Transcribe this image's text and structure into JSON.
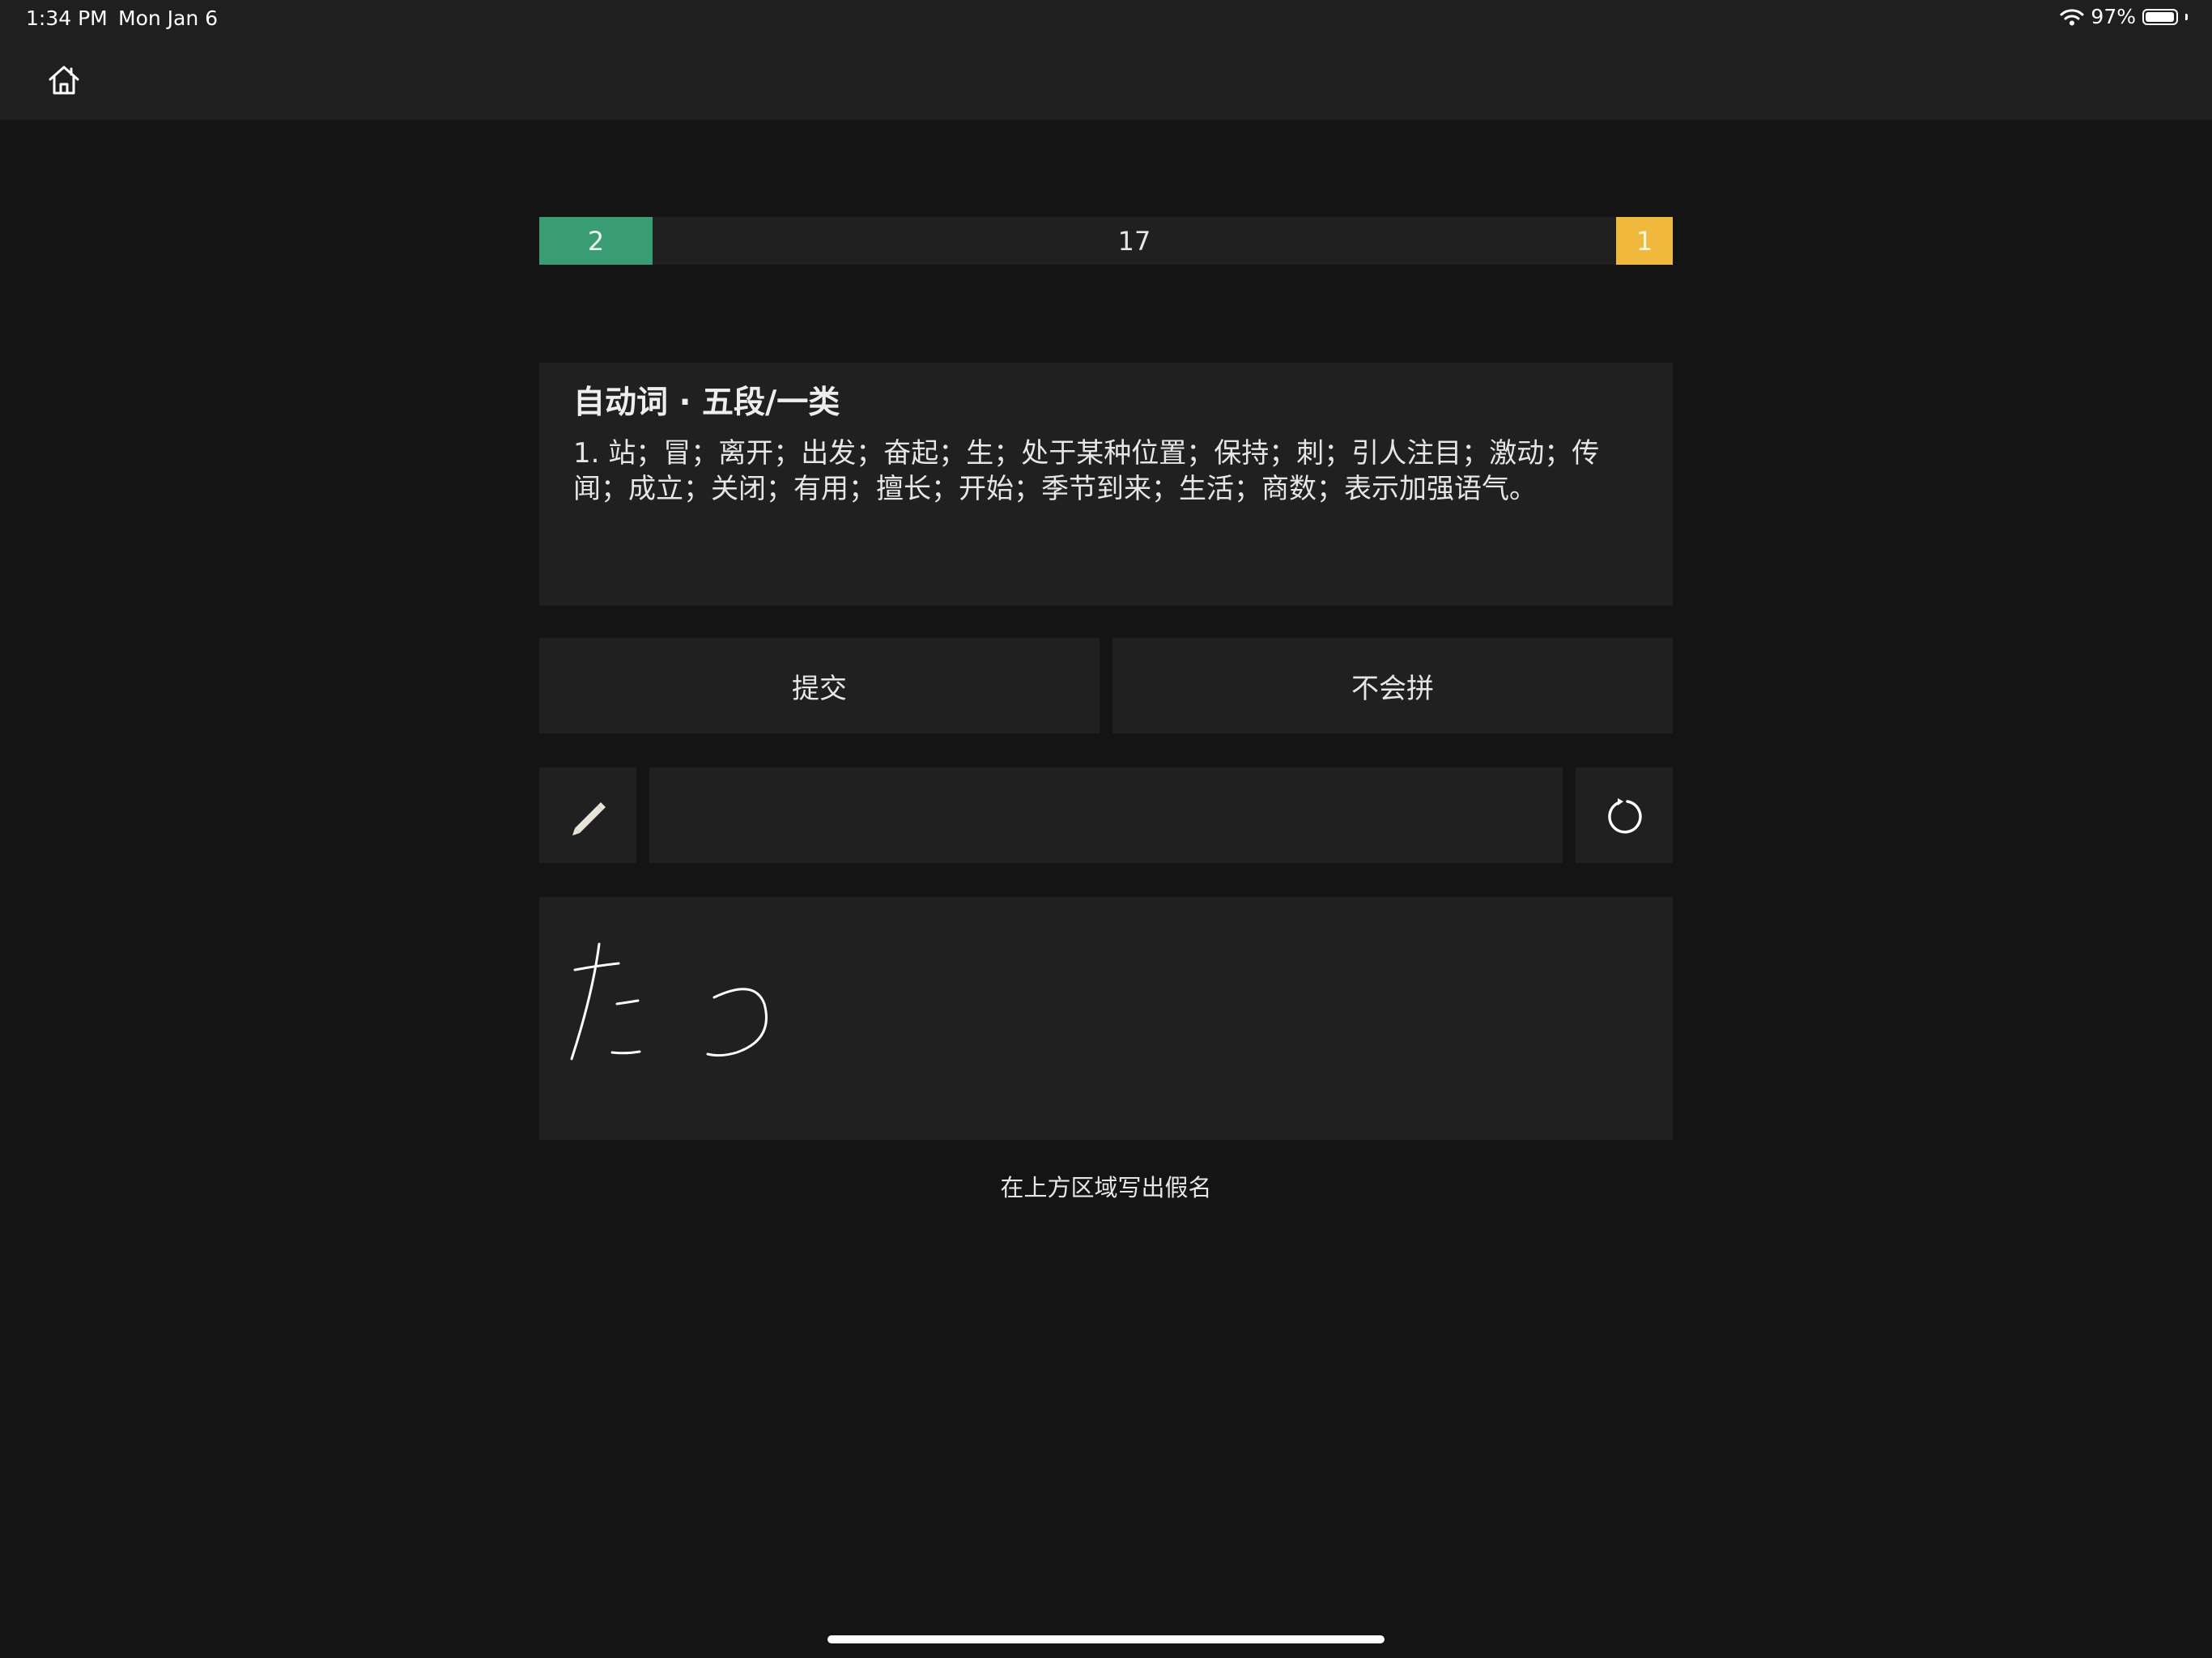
{
  "status_bar": {
    "time": "1:34 PM",
    "date": "Mon Jan 6",
    "battery": "97%",
    "battery_level": 0.97
  },
  "nav": {
    "home_icon": "home-icon"
  },
  "progress": {
    "correct": "2",
    "remaining": "17",
    "wrong": "1",
    "correct_color": "#3a9c73",
    "wrong_color": "#f0b93c"
  },
  "card": {
    "word_type": "自动词 · 五段/一类",
    "meaning": "1. 站；冒；离开；出发；奋起；生；处于某种位置；保持；刺；引人注目；激动；传闻；成立；关闭；有用；擅长；开始；季节到来；生活；商数；表示加强语气。"
  },
  "actions": {
    "submit": "提交",
    "dont_know": "不会拼"
  },
  "input": {
    "value": "",
    "pencil_icon": "pencil-icon",
    "reset_icon": "refresh-icon"
  },
  "handwriting": {
    "strokes_text": "たつ"
  },
  "hint": "在上方区域写出假名"
}
